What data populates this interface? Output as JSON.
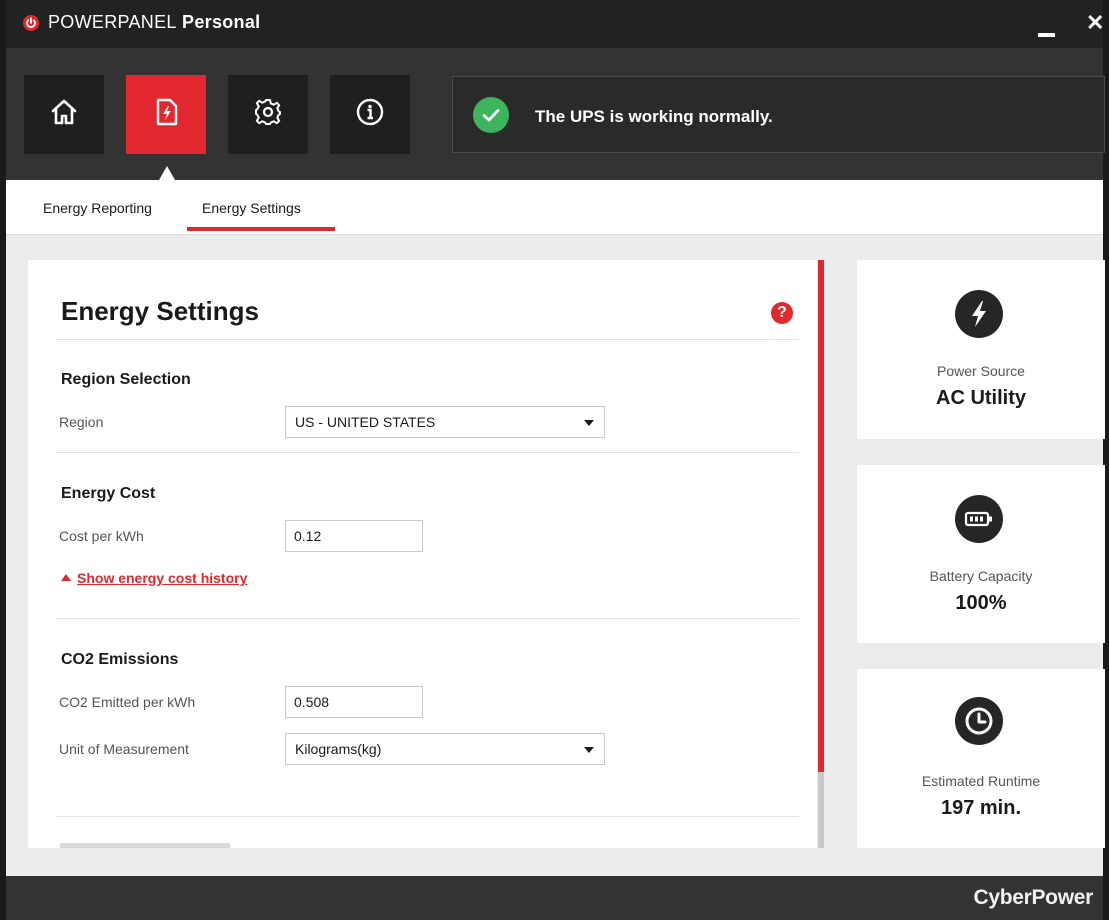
{
  "app": {
    "title_part1": "POWER",
    "title_part2": "PANEL",
    "title_part3": " Personal"
  },
  "nav": {
    "items": [
      {
        "icon": "home-icon"
      },
      {
        "icon": "energy-report-icon",
        "active": true
      },
      {
        "icon": "gear-icon"
      },
      {
        "icon": "info-icon"
      }
    ]
  },
  "status": {
    "message": "The UPS is working normally.",
    "color": "#3cb55d"
  },
  "tabs": [
    {
      "label": "Energy Reporting"
    },
    {
      "label": "Energy Settings",
      "active": true
    }
  ],
  "panel": {
    "title": "Energy Settings",
    "help": "?",
    "region_section": {
      "title": "Region Selection",
      "label": "Region",
      "value": "US - UNITED STATES"
    },
    "cost_section": {
      "title": "Energy Cost",
      "label": "Cost per kWh",
      "value": "0.12",
      "history_link": "Show energy cost history"
    },
    "co2_section": {
      "title": "CO2 Emissions",
      "emitted_label": "CO2 Emitted per kWh",
      "emitted_value": "0.508",
      "unit_label": "Unit of Measurement",
      "unit_value": "Kilograms(kg)"
    }
  },
  "cards": [
    {
      "icon": "lightning-icon",
      "label": "Power Source",
      "value": "AC Utility"
    },
    {
      "icon": "battery-icon",
      "label": "Battery Capacity",
      "value": "100%"
    },
    {
      "icon": "clock-icon",
      "label": "Estimated Runtime",
      "value": "197 min."
    }
  ],
  "footer": {
    "brand": "CyberPower"
  },
  "colors": {
    "accent": "#e0282e",
    "dark": "#222222",
    "nav_band": "#333333"
  }
}
